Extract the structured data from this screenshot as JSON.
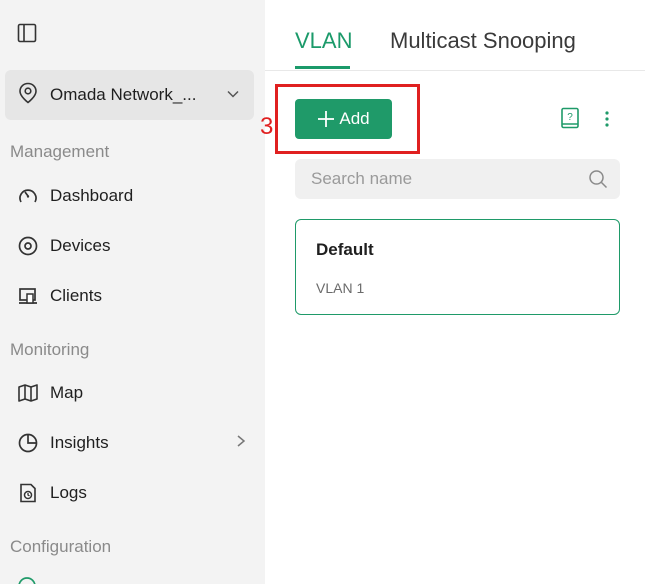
{
  "sidebar": {
    "site_selector": {
      "label": "Omada Network_..."
    },
    "sections": {
      "management": "Management",
      "monitoring": "Monitoring",
      "configuration": "Configuration"
    },
    "items": {
      "dashboard": "Dashboard",
      "devices": "Devices",
      "clients": "Clients",
      "map": "Map",
      "insights": "Insights",
      "logs": "Logs"
    }
  },
  "tabs": {
    "vlan": "VLAN",
    "multicast": "Multicast Snooping"
  },
  "toolbar": {
    "add_label": "Add"
  },
  "annotation": {
    "step_number": "3"
  },
  "search": {
    "placeholder": "Search name"
  },
  "vlan_cards": [
    {
      "name": "Default",
      "subtitle": "VLAN 1"
    }
  ],
  "colors": {
    "accent": "#1f9a69",
    "annotation": "#e02020",
    "sidebar_bg": "#f3f3f3"
  }
}
